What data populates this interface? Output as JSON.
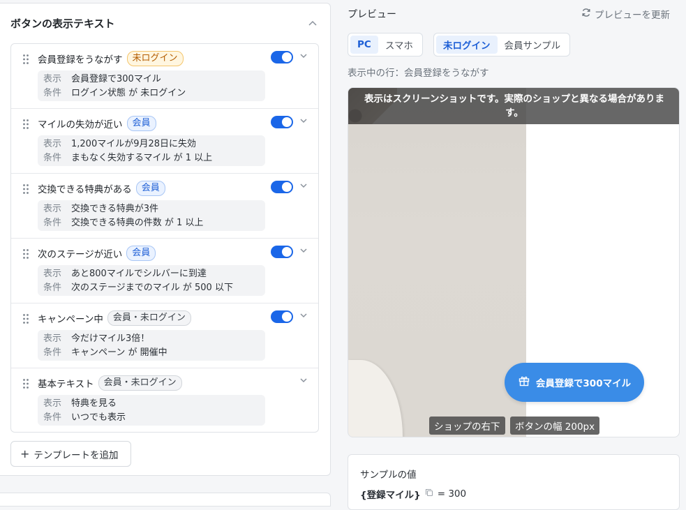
{
  "left": {
    "title": "ボタンの表示テキスト",
    "rules": [
      {
        "name": "会員登録をうながす",
        "badge": "未ログイン",
        "badge_style": "orange",
        "toggle": true,
        "display_label": "表示",
        "display": "会員登録で300マイル",
        "cond_label": "条件",
        "condition": "ログイン状態 が 未ログイン"
      },
      {
        "name": "マイルの失効が近い",
        "badge": "会員",
        "badge_style": "blue",
        "toggle": true,
        "display_label": "表示",
        "display": "1,200マイルが9月28日に失効",
        "cond_label": "条件",
        "condition": "まもなく失効するマイル が 1 以上"
      },
      {
        "name": "交換できる特典がある",
        "badge": "会員",
        "badge_style": "blue",
        "toggle": true,
        "display_label": "表示",
        "display": "交換できる特典が3件",
        "cond_label": "条件",
        "condition": "交換できる特典の件数 が 1 以上"
      },
      {
        "name": "次のステージが近い",
        "badge": "会員",
        "badge_style": "blue",
        "toggle": true,
        "display_label": "表示",
        "display": "あと800マイルでシルバーに到達",
        "cond_label": "条件",
        "condition": "次のステージまでのマイル が 500 以下"
      },
      {
        "name": "キャンペーン中",
        "badge": "会員・未ログイン",
        "badge_style": "gray",
        "toggle": true,
        "display_label": "表示",
        "display": "今だけマイル3倍！",
        "cond_label": "条件",
        "condition": "キャンペーン が 開催中"
      },
      {
        "name": "基本テキスト",
        "badge": "会員・未ログイン",
        "badge_style": "gray",
        "toggle": false,
        "display_label": "表示",
        "display": "特典を見る",
        "cond_label": "条件",
        "condition": "いつでも表示"
      }
    ],
    "add_template": "テンプレートを追加"
  },
  "preview": {
    "title": "プレビュー",
    "refresh": "プレビューを更新",
    "device_tabs": [
      "PC",
      "スマホ"
    ],
    "device_active": 0,
    "user_tabs": [
      "未ログイン",
      "会員サンプル"
    ],
    "user_active": 0,
    "current_row": "表示中の行：会員登録をうながす",
    "notice": "表示はスクリーンショットです。実際のショップと異なる場合があります。",
    "cta_label": "会員登録で300マイル",
    "tag_position": "ショップの右下",
    "tag_width": "ボタンの幅 200px"
  },
  "sample": {
    "title": "サンプルの値",
    "key": "{登録マイル}",
    "value": "= 300"
  },
  "colors": {
    "accent": "#1a66e8",
    "cta": "#3a8ce7"
  }
}
